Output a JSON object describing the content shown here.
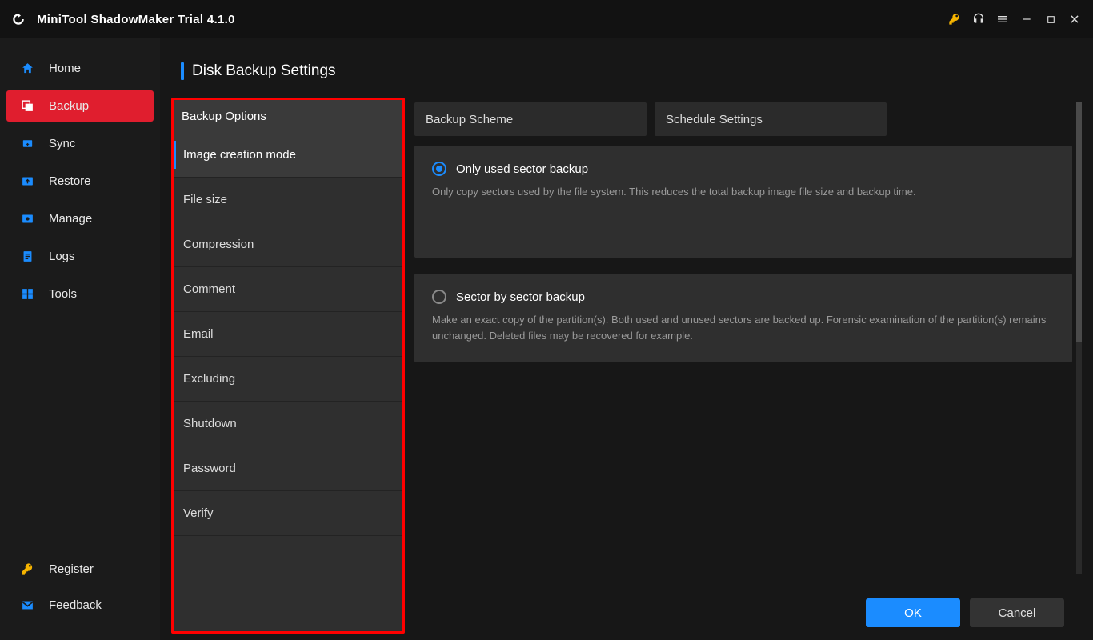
{
  "app": {
    "title": "MiniTool ShadowMaker Trial 4.1.0"
  },
  "sidebar": {
    "items": [
      {
        "label": "Home"
      },
      {
        "label": "Backup"
      },
      {
        "label": "Sync"
      },
      {
        "label": "Restore"
      },
      {
        "label": "Manage"
      },
      {
        "label": "Logs"
      },
      {
        "label": "Tools"
      }
    ],
    "bottom": {
      "register": "Register",
      "feedback": "Feedback"
    }
  },
  "header": {
    "title": "Disk Backup Settings"
  },
  "tabs": {
    "options": "Backup Options",
    "scheme": "Backup Scheme",
    "schedule": "Schedule Settings"
  },
  "options_list": [
    "Image creation mode",
    "File size",
    "Compression",
    "Comment",
    "Email",
    "Excluding",
    "Shutdown",
    "Password",
    "Verify"
  ],
  "image_mode": {
    "used": {
      "label": "Only used sector backup",
      "desc": "Only copy sectors used by the file system. This reduces the total backup image file size and backup time."
    },
    "sector": {
      "label": "Sector by sector backup",
      "desc": "Make an exact copy of the partition(s). Both used and unused sectors are backed up. Forensic examination of the partition(s) remains unchanged. Deleted files may be recovered for example."
    }
  },
  "buttons": {
    "ok": "OK",
    "cancel": "Cancel"
  }
}
